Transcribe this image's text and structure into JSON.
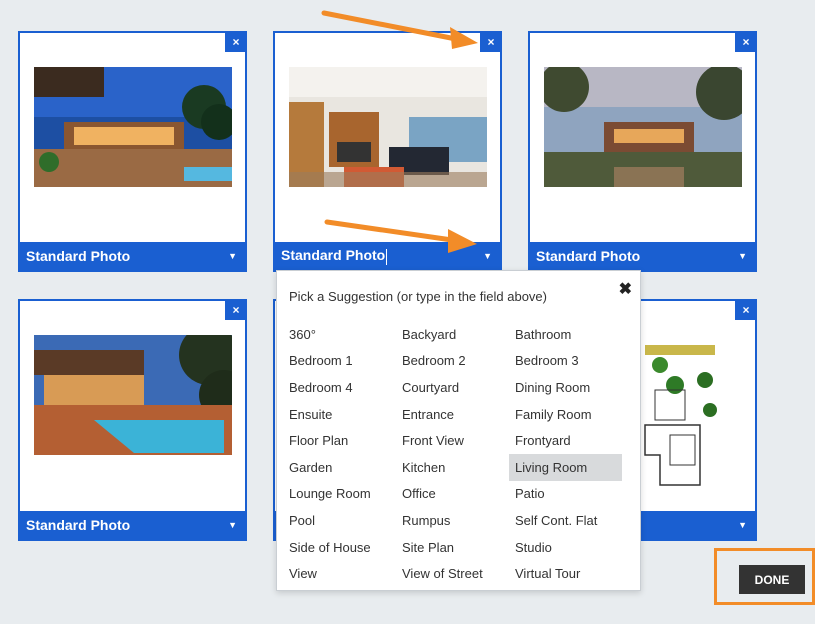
{
  "cards": [
    {
      "label": "Standard Photo",
      "close": "×"
    },
    {
      "label": "Standard Photo",
      "close": "×"
    },
    {
      "label": "Standard Photo",
      "close": "×"
    },
    {
      "label": "Standard Photo",
      "close": "×"
    },
    {
      "close": "×"
    },
    {
      "close": "×"
    }
  ],
  "dropdown": {
    "title": "Pick a Suggestion (or type in the field above)",
    "close": "✖",
    "selected": "Living Room",
    "options": [
      "360°",
      "Backyard",
      "Bathroom",
      "Bedroom 1",
      "Bedroom 2",
      "Bedroom 3",
      "Bedroom 4",
      "Courtyard",
      "Dining Room",
      "Ensuite",
      "Entrance",
      "Family Room",
      "Floor Plan",
      "Front View",
      "Frontyard",
      "Garden",
      "Kitchen",
      "Living Room",
      "Lounge Room",
      "Office",
      "Patio",
      "Pool",
      "Rumpus",
      "Self Cont. Flat",
      "Side of House",
      "Site Plan",
      "Studio",
      "View",
      "View of Street",
      "Virtual Tour"
    ]
  },
  "done_label": "DONE",
  "colors": {
    "accent": "#1a5fd1",
    "highlight": "#f28c28"
  }
}
